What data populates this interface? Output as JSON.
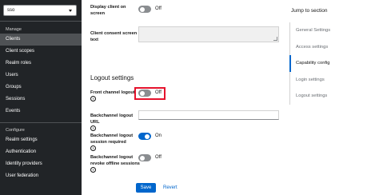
{
  "sidebar": {
    "realm": "sso",
    "manage_header": "Manage",
    "manage_items": [
      "Clients",
      "Client scopes",
      "Realm roles",
      "Users",
      "Groups",
      "Sessions",
      "Events"
    ],
    "configure_header": "Configure",
    "configure_items": [
      "Realm settings",
      "Authentication",
      "Identity providers",
      "User federation"
    ]
  },
  "form": {
    "display_client_label_1": "Display client on",
    "display_client_label_2": "screen",
    "display_client_state": "Off",
    "consent_label_1": "Client consent screen",
    "consent_label_2": "text",
    "logout_section": "Logout settings",
    "front_channel_label": "Front channel logout",
    "front_channel_state": "Off",
    "backchannel_url_label_1": "Backchannel logout",
    "backchannel_url_label_2": "URL",
    "backchannel_session_label_1": "Backchannel logout",
    "backchannel_session_label_2": "session required",
    "backchannel_session_state": "On",
    "backchannel_revoke_label_1": "Backchannel logout",
    "backchannel_revoke_label_2": "revoke offline sessions",
    "backchannel_revoke_state": "Off",
    "help": "?"
  },
  "actions": {
    "save": "Save",
    "revert": "Revert"
  },
  "jump": {
    "title": "Jump to section",
    "items": [
      "General Settings",
      "Access settings",
      "Capability config",
      "Login settings",
      "Logout settings"
    ]
  },
  "colors": {
    "accent": "#0066cc",
    "highlight": "#e5132d",
    "sidebar": "#212427"
  },
  "icons": {
    "help": "help-circle-icon",
    "caret": "caret-down-icon"
  }
}
